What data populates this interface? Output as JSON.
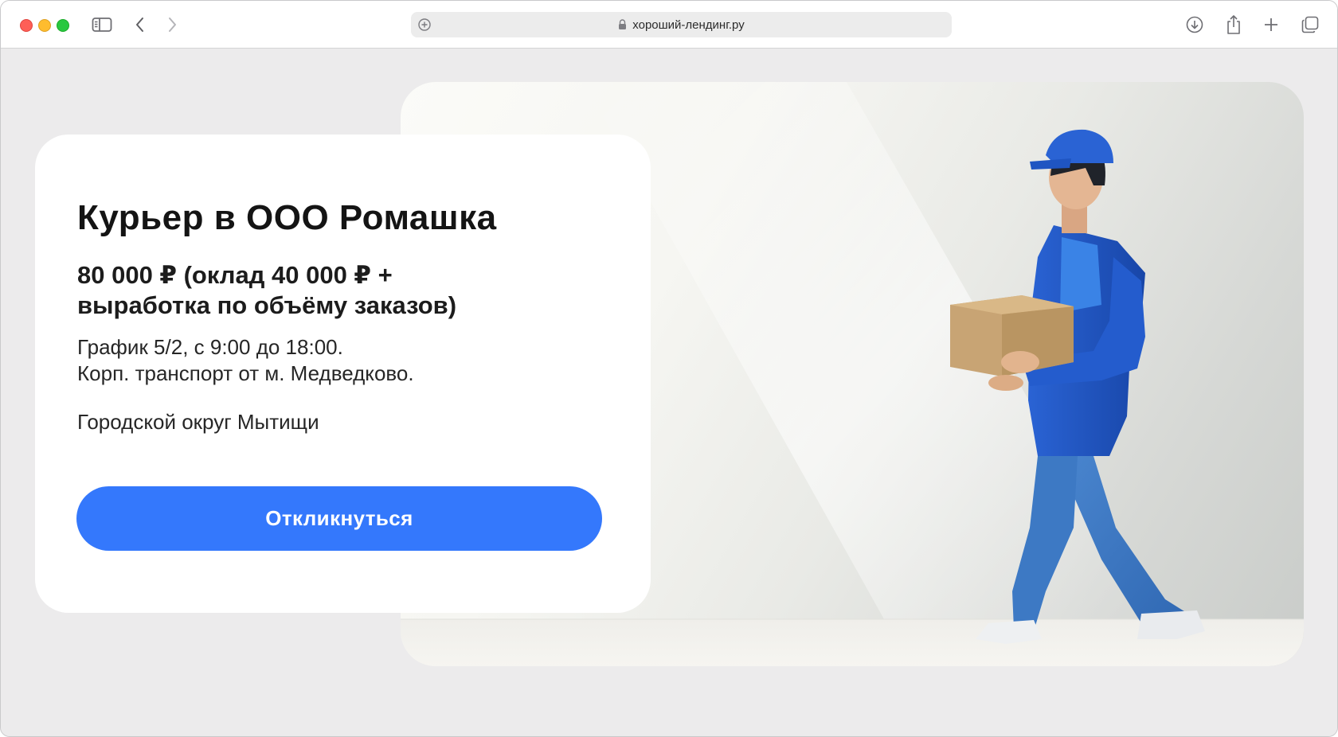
{
  "browser": {
    "url": "хороший-лендинг.ру",
    "icons": [
      "sidebar-icon",
      "back-icon",
      "forward-icon",
      "site-settings-icon",
      "lock-icon",
      "download-icon",
      "share-icon",
      "new-tab-icon",
      "tabs-overview-icon"
    ]
  },
  "vacancy": {
    "title": "Курьер в ООО Ромашка",
    "salary": "80 000 ₽ (оклад 40 000 ₽ + выработка по объёму заказов)",
    "schedule": "График 5/2, с 9:00 до 18:00.",
    "transport": "Корп. транспорт от м. Медведково.",
    "location": "Городской округ Мытищи",
    "apply_label": "Откликнуться"
  },
  "colors": {
    "accent_button": "#3478fc",
    "page_background": "#ecebec",
    "card_background": "#ffffff",
    "courier_uniform": "#2259c9"
  }
}
